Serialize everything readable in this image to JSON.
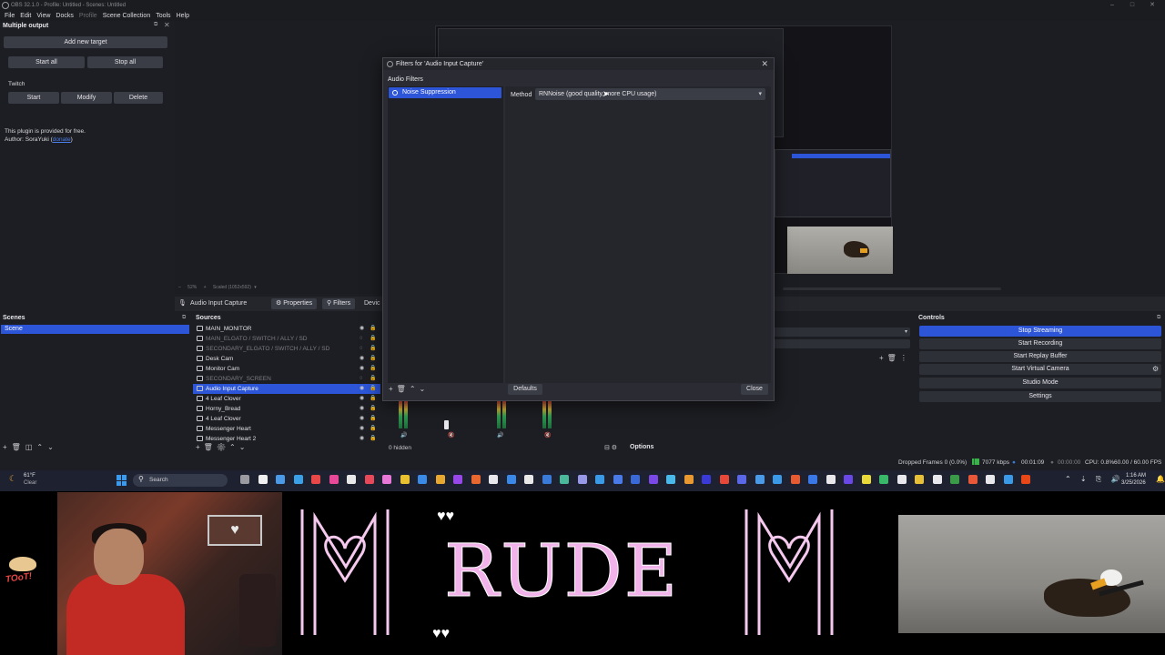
{
  "window": {
    "title": "OBS 32.1.0 - Profile: Untitled - Scenes: Untitled"
  },
  "menu": [
    "File",
    "Edit",
    "View",
    "Docks",
    "Profile",
    "Scene Collection",
    "Tools",
    "Help"
  ],
  "multiple_output": {
    "title": "Multiple output",
    "add_target": "Add new target",
    "start_all": "Start all",
    "stop_all": "Stop all",
    "target_name": "Twitch",
    "start": "Start",
    "modify": "Modify",
    "delete": "Delete",
    "free_notice": "This plugin is provided for free.",
    "author_prefix": "Author: SoraYuki (",
    "donate": "donate",
    "author_suffix": ")"
  },
  "preview": {
    "zoom": "52%",
    "scaled": "Scaled (1052x592)"
  },
  "context_bar": {
    "source": "Audio Input Capture",
    "properties": "Properties",
    "filters": "Filters",
    "device": "Devic"
  },
  "scenes": {
    "title": "Scenes",
    "items": [
      "Scene"
    ]
  },
  "sources": {
    "title": "Sources",
    "items": [
      {
        "label": "MAIN_MONITOR",
        "dim": false
      },
      {
        "label": "MAIN_ELGATO / SWITCH / ALLY / SD",
        "dim": true
      },
      {
        "label": "SECONDARY_ELGATO / SWITCH / ALLY / SD",
        "dim": true
      },
      {
        "label": "Desk Cam",
        "dim": false
      },
      {
        "label": "Monitor Cam",
        "dim": false
      },
      {
        "label": "SECONDARY_SCREEN",
        "dim": true
      },
      {
        "label": "Audio Input Capture",
        "dim": false,
        "selected": true
      },
      {
        "label": "4 Leaf Clover",
        "dim": false
      },
      {
        "label": "Horny_Bread",
        "dim": false
      },
      {
        "label": "4 Leaf Clover",
        "dim": false
      },
      {
        "label": "Messenger Heart",
        "dim": false
      },
      {
        "label": "Messenger Heart 2",
        "dim": false
      }
    ]
  },
  "mixer": {
    "hidden": "0 hidden",
    "options": "Options"
  },
  "controls": {
    "title": "Controls",
    "buttons": [
      "Stop Streaming",
      "Start Recording",
      "Start Replay Buffer",
      "Start Virtual Camera",
      "Studio Mode",
      "Settings"
    ]
  },
  "status": {
    "dropped": "Dropped Frames 0 (0.0%)",
    "kbps": "7077 kbps",
    "stream_time": "00:01:09",
    "rec_time": "00:00:00",
    "cpu": "CPU: 0.8%",
    "fps": "60.00 / 60.00 FPS"
  },
  "filters_dialog": {
    "title": "Filters for 'Audio Input Capture'",
    "section": "Audio Filters",
    "filter": "Noise Suppression",
    "method_label": "Method",
    "method_value": "RNNoise (good quality, more CPU usage)",
    "defaults": "Defaults",
    "close": "Close"
  },
  "taskbar": {
    "weather_temp": "61°F",
    "weather_text": "Clear",
    "search": "Search",
    "time": "1:16 AM",
    "date": "3/25/2026"
  },
  "overlay": {
    "title": "RUDE",
    "sticker": "TOoT!",
    "colors": {
      "title": "#f2b3ea",
      "frame": "#f5c8ee"
    }
  }
}
